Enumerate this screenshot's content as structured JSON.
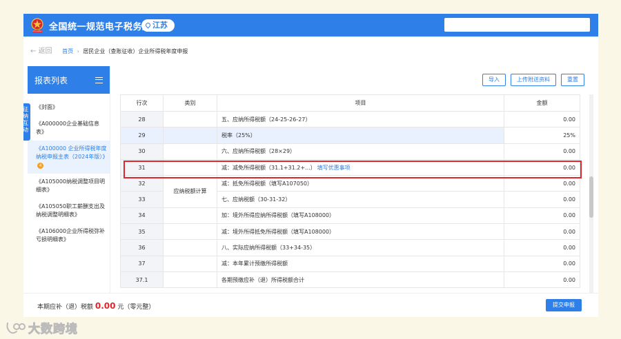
{
  "header": {
    "site_title": "全国统一规范电子税务局",
    "region": "江苏",
    "emblem_text": "ChinaTax"
  },
  "breadcrumb": {
    "back": "返回",
    "home": "首页",
    "sep": "›",
    "current": "居民企业（查账征收）企业所得税年度申报"
  },
  "sidebar": {
    "title": "报表列表",
    "items": [
      {
        "label": "《封面》"
      },
      {
        "label": "《A000000企业基础信息表》"
      },
      {
        "label": "《A100000 企业所得税年度纳税申报主表（2024年版）》",
        "badge": "4"
      },
      {
        "label": "《A105000纳税调整项目明细表》"
      },
      {
        "label": "《A105050职工薪酬支出及纳税调整明细表》"
      },
      {
        "label": "《A106000企业所得税弥补亏损明细表》"
      }
    ],
    "side_tab": "征纳互动"
  },
  "toolbar": {
    "import": "导入",
    "upload": "上传附送资料",
    "reset": "重置"
  },
  "table": {
    "headers": {
      "row": "行次",
      "category": "类别",
      "item": "项目",
      "amount": "金额"
    },
    "category_label": "应纳税额计算",
    "fill_link": "填写优惠事项",
    "rows": [
      {
        "no": "28",
        "item": "五、应纳所得税额（24-25-26-27）",
        "amount": "0.00"
      },
      {
        "no": "29",
        "item": "税率（25%）",
        "amount": "25%"
      },
      {
        "no": "30",
        "item": "六、应纳所得税额（28×29）",
        "amount": "0.00"
      },
      {
        "no": "31",
        "item": "减：减免所得税额（31.1+31.2+...）",
        "amount": "0.00"
      },
      {
        "no": "32",
        "item": "减：抵免所得税额（填写A107050）",
        "amount": "0.00"
      },
      {
        "no": "33",
        "item": "七、应纳税额（30-31-32）",
        "amount": "0.00"
      },
      {
        "no": "34",
        "item": "加：境外所得应纳所得税额（填写A108000）",
        "amount": "0.00"
      },
      {
        "no": "35",
        "item": "减：境外所得抵免所得税额（填写A108000）",
        "amount": "0.00"
      },
      {
        "no": "36",
        "item": "八、实际应纳所得税额（33+34-35）",
        "amount": "0.00"
      },
      {
        "no": "37",
        "item": "减：本年累计预缴所得税额",
        "amount": "0.00"
      },
      {
        "no": "37.1",
        "item": "各期预缴应补（退）所得税额合计",
        "amount": "0.00"
      }
    ]
  },
  "footer": {
    "prefix": "本期应补（退）税额",
    "amount": "0.00",
    "suffix": "元（零元整）",
    "submit": "提交申报"
  },
  "watermark": {
    "text": "大数跨境"
  },
  "colors": {
    "primary": "#2f7fe8",
    "highlight": "#e0262d",
    "badge": "#f5a020"
  }
}
